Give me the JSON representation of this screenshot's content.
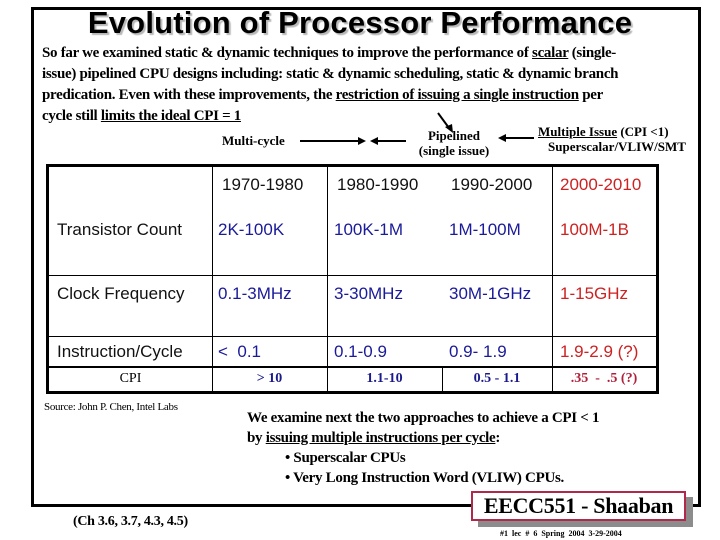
{
  "slide": {
    "title": "Evolution of Processor Performance",
    "intro_lines": [
      {
        "pre": "So far we examined static & dynamic techniques to improve the performance of ",
        "u": "scalar",
        "post": "  (single-"
      },
      {
        "pre": "issue) pipelined CPU designs including: static & dynamic scheduling,  static & dynamic branch",
        "u": "",
        "post": ""
      },
      {
        "pre": "predication.   Even with these improvements, the ",
        "u": "restriction of issuing a single instruction",
        "post": " per"
      },
      {
        "pre": "cycle still ",
        "u": "limits the ideal CPI = 1",
        "post": ""
      }
    ],
    "flow": {
      "multi_cycle": "Multi-cycle",
      "pipelined_line1": "Pipelined",
      "pipelined_line2": "(single issue)",
      "multiple_issue": "Multiple Issue",
      "multiple_issue_cpi": "  (CPI <1)",
      "superscalar": "Superscalar/VLIW/SMT"
    },
    "table": {
      "decades": [
        {
          "label": "1970-1980",
          "color": "black"
        },
        {
          "label": "1980-1990",
          "color": "black"
        },
        {
          "label": "1990-2000",
          "color": "black"
        },
        {
          "label": "2000-2010",
          "color": "red"
        }
      ],
      "rows": [
        {
          "label": "Transistor Count",
          "values": [
            "2K-100K",
            "100K-1M",
            "1M-100M",
            "100M-1B"
          ]
        },
        {
          "label": "Clock Frequency",
          "values": [
            "0.1-3MHz",
            "3-30MHz",
            "30M-1GHz",
            "1-15GHz"
          ]
        },
        {
          "label": "Instruction/Cycle",
          "values": [
            "<  0.1",
            "0.1-0.9",
            "0.9- 1.9",
            "1.9-2.9 (?)"
          ]
        }
      ],
      "cpi_row": {
        "label": "CPI",
        "values": [
          "> 10",
          "1.1-10",
          "0.5 - 1.1",
          ".35  -  .5 (?)"
        ]
      }
    },
    "source": "Source:  John P. Chen, Intel Labs",
    "next": {
      "line1": "We examine next the two approaches to achieve  a CPI < 1",
      "line2_pre": "by ",
      "line2_u": "issuing  multiple instructions per cycle",
      "line2_post": ":",
      "bullets": [
        "Superscalar CPUs",
        "Very Long Instruction Word (VLIW) CPUs."
      ]
    },
    "chapters": "(Ch 3.6,  3.7,  4.3,  4.5)",
    "badge": "EECC551 - Shaaban",
    "footer_meta": "#1  lec # 6   Spring 2004  3-29-2004",
    "colors": {
      "blue": "#1a1a9a",
      "red": "#cc2222",
      "badge_border": "#b0284a"
    }
  }
}
